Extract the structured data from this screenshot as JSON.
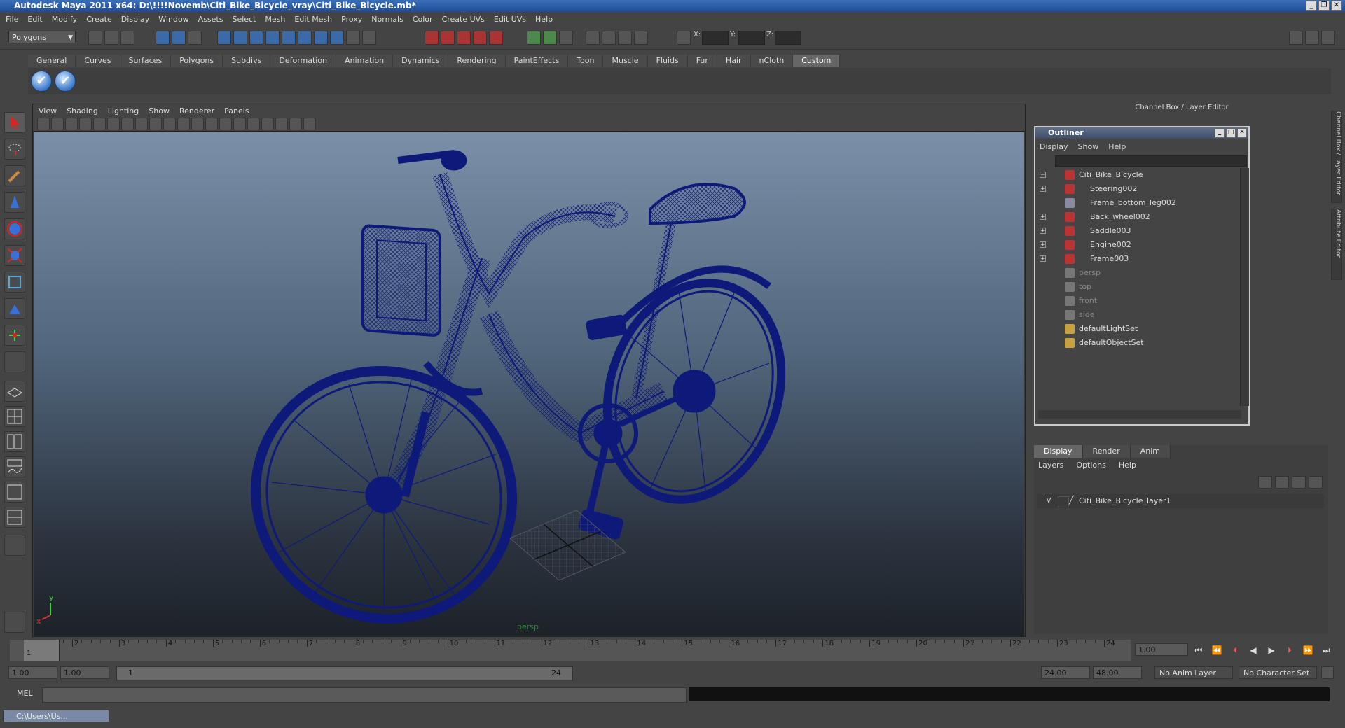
{
  "window": {
    "title": "Autodesk Maya 2011 x64: D:\\!!!!Novemb\\Citi_Bike_Bicycle_vray\\Citi_Bike_Bicycle.mb*"
  },
  "menubar": [
    "File",
    "Edit",
    "Modify",
    "Create",
    "Display",
    "Window",
    "Assets",
    "Select",
    "Mesh",
    "Edit Mesh",
    "Proxy",
    "Normals",
    "Color",
    "Create UVs",
    "Edit UVs",
    "Help"
  ],
  "statusline": {
    "mode": "Polygons",
    "coord_labels": [
      "X:",
      "Y:",
      "Z:"
    ]
  },
  "shelf": {
    "tabs": [
      "General",
      "Curves",
      "Surfaces",
      "Polygons",
      "Subdivs",
      "Deformation",
      "Animation",
      "Dynamics",
      "Rendering",
      "PaintEffects",
      "Toon",
      "Muscle",
      "Fluids",
      "Fur",
      "Hair",
      "nCloth",
      "Custom"
    ],
    "active_tab": "Custom"
  },
  "viewport": {
    "menu": [
      "View",
      "Shading",
      "Lighting",
      "Show",
      "Renderer",
      "Panels"
    ],
    "camera_label": "persp",
    "axis_x": "x",
    "axis_y": "y"
  },
  "channel_box": {
    "title": "Channel Box / Layer Editor",
    "side_tabs": [
      "Channel Box / Layer Editor",
      "Attribute Editor"
    ]
  },
  "outliner": {
    "title": "Outliner",
    "menu": [
      "Display",
      "Show",
      "Help"
    ],
    "items": [
      {
        "label": "Citi_Bike_Bicycle",
        "expander": "−",
        "dim": false
      },
      {
        "label": "Steering002",
        "expander": "+",
        "dim": false
      },
      {
        "label": "Frame_bottom_leg002",
        "expander": "",
        "dim": false
      },
      {
        "label": "Back_wheel002",
        "expander": "+",
        "dim": false
      },
      {
        "label": "Saddle003",
        "expander": "+",
        "dim": false
      },
      {
        "label": "Engine002",
        "expander": "+",
        "dim": false
      },
      {
        "label": "Frame003",
        "expander": "+",
        "dim": false
      },
      {
        "label": "persp",
        "expander": "",
        "dim": true
      },
      {
        "label": "top",
        "expander": "",
        "dim": true
      },
      {
        "label": "front",
        "expander": "",
        "dim": true
      },
      {
        "label": "side",
        "expander": "",
        "dim": true
      },
      {
        "label": "defaultLightSet",
        "expander": "",
        "dim": false
      },
      {
        "label": "defaultObjectSet",
        "expander": "",
        "dim": false
      }
    ]
  },
  "layer_editor": {
    "tabs": [
      "Display",
      "Render",
      "Anim"
    ],
    "active_tab": "Display",
    "menu": [
      "Layers",
      "Options",
      "Help"
    ],
    "layer": {
      "visibility": "V",
      "name": "Citi_Bike_Bicycle_layer1"
    }
  },
  "timeline": {
    "ticks": [
      "1",
      "2",
      "3",
      "4",
      "5",
      "6",
      "7",
      "8",
      "9",
      "10",
      "11",
      "12",
      "13",
      "14",
      "15",
      "16",
      "17",
      "18",
      "19",
      "20",
      "21",
      "22",
      "23",
      "24"
    ],
    "current_frame": "1.00",
    "current_marker": "1"
  },
  "range": {
    "start": "1.00",
    "playback_start": "1.00",
    "slider_start": "1",
    "slider_end": "24",
    "playback_end": "24.00",
    "end": "48.00",
    "anim_layer": "No Anim Layer",
    "char_set": "No Character Set"
  },
  "command_line": {
    "label": "MEL"
  },
  "taskbar": {
    "item": "C:\\Users\\Us..."
  },
  "colors": {
    "wireframe": "#0e1a7a",
    "accent": "#3a6fb8"
  }
}
